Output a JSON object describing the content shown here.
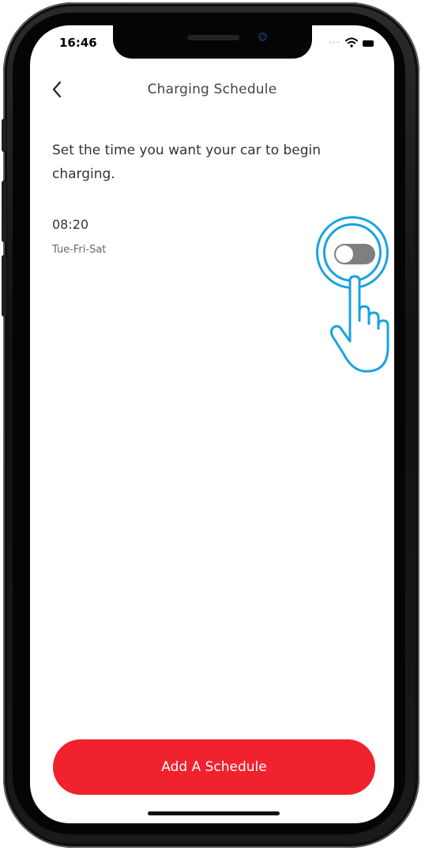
{
  "status_bar": {
    "time": "16:46",
    "signal_dots": "...",
    "icons": [
      "wifi-icon",
      "battery-icon"
    ]
  },
  "nav": {
    "back_icon": "chevron-left-icon",
    "title": "Charging Schedule"
  },
  "description": "Set the time you want your car to begin charging.",
  "schedules": [
    {
      "time": "08:20",
      "days": "Tue-Fri-Sat",
      "enabled": false
    }
  ],
  "overlay": {
    "tap_indicator_color": "#1aa3e0",
    "hand_icon": "pointing-hand-icon"
  },
  "buttons": {
    "add_schedule": "Add A Schedule"
  },
  "colors": {
    "accent": "#f0222e",
    "toggle_off": "#7f7f7f",
    "tap_indicator": "#1aa3e0"
  }
}
